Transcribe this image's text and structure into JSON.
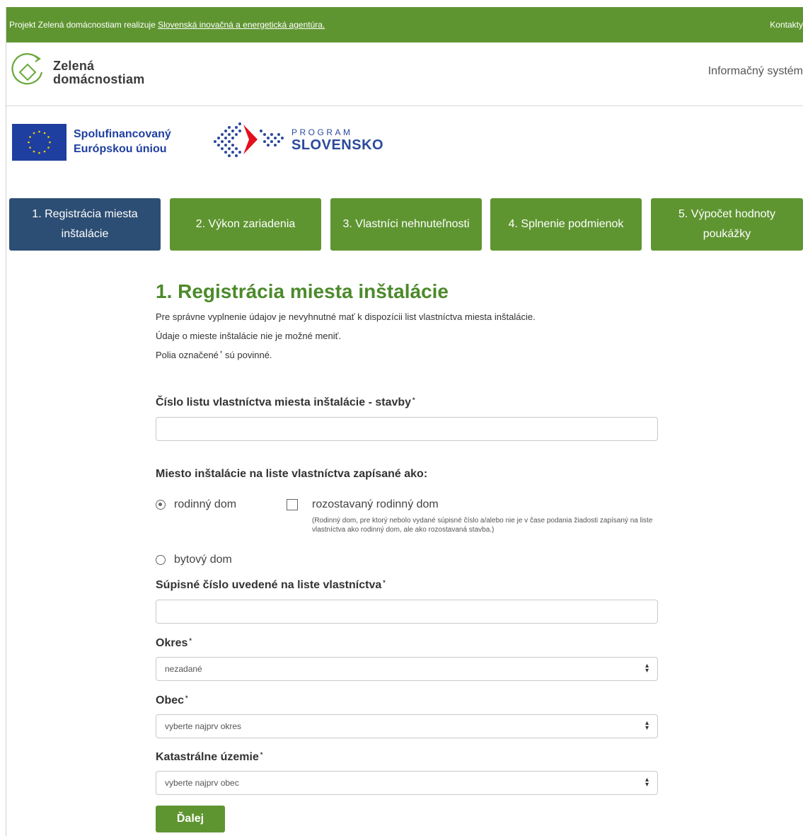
{
  "topbar": {
    "info_prefix": "Projekt Zelená domácnostiam realizuje ",
    "agency_link": "Slovenská inovačná a energetická agentúra.",
    "contacts": "Kontakty"
  },
  "header": {
    "logo_line1": "Zelená",
    "logo_line2": "domácnostiam",
    "system_label": "Informačný systém"
  },
  "partners": {
    "eu_line1": "Spolufinancovaný",
    "eu_line2": "Európskou úniou",
    "program_label": "PROGRAM",
    "program_name": "SLOVENSKO"
  },
  "steps": [
    {
      "label": "1. Registrácia miesta inštalácie",
      "active": true
    },
    {
      "label": "2. Výkon zariadenia",
      "active": false
    },
    {
      "label": "3. Vlastníci nehnuteľnosti",
      "active": false
    },
    {
      "label": "4. Splnenie podmienok",
      "active": false
    },
    {
      "label": "5. Výpočet hodnoty poukážky",
      "active": false
    }
  ],
  "form": {
    "title": "1. Registrácia miesta inštalácie",
    "desc1": "Pre správne vyplnenie údajov je nevyhnutné mať k dispozícii list vlastníctva miesta inštalácie.",
    "desc2": "Údaje o mieste inštalácie nie je možné meniť.",
    "desc3_a": "Polia označené",
    "desc3_b": "sú povinné.",
    "required_mark": "*",
    "lv_label": "Číslo listu vlastníctva miesta inštalácie - stavby",
    "lv_value": "",
    "type_label": "Miesto inštalácie na liste vlastníctva zapísané ako:",
    "opt_family": "rodinný dom",
    "opt_family_checked": true,
    "opt_under_construction": "rozostavaný rodinný dom",
    "opt_under_construction_checked": false,
    "opt_note": "(Rodinný dom, pre ktorý nebolo vydané súpisné číslo a/alebo nie je v čase podania žiadosti zapísaný na liste vlastníctva ako rodinný dom, ale ako rozostavaná stavba.)",
    "opt_apartment": "bytový dom",
    "opt_apartment_checked": false,
    "supisne_label": "Súpisné číslo uvedené na liste vlastníctva",
    "supisne_value": "",
    "okres_label": "Okres",
    "okres_value": "nezadané",
    "obec_label": "Obec",
    "obec_value": "vyberte najprv okres",
    "kat_label": "Katastrálne územie",
    "kat_value": "vyberte najprv obec",
    "next_button": "Ďalej"
  },
  "colors": {
    "green": "#5f9531",
    "active_step": "#2d4e74",
    "title_green": "#4c8a2b",
    "eu_blue": "#1f3fa0"
  }
}
